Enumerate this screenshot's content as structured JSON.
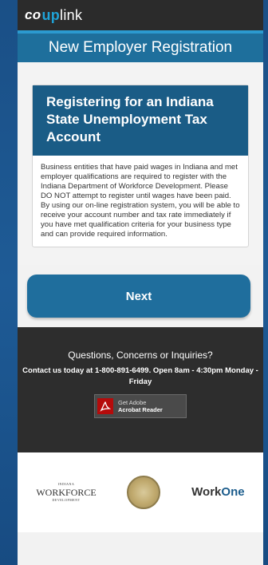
{
  "brand": {
    "co": "co",
    "up": "up",
    "link": "link"
  },
  "page_title": "New Employer Registration",
  "card": {
    "heading": "Registering for an Indiana State Unemployment Tax Account",
    "body": "Business entities that have paid wages in Indiana and met employer qualifications are required to register with the Indiana Department of Workforce Development. Please DO NOT attempt to register until wages have been paid. By using our on-line registration system, you will be able to receive your account number and tax rate immediately if you have met qualification criteria for your business type and can provide required information."
  },
  "next_label": "Next",
  "footer": {
    "question": "Questions, Concerns or Inquiries?",
    "contact": "Contact us today at 1-800-891-6499. Open 8am - 4:30pm Monday - Friday",
    "adobe_small": "Get Adobe",
    "adobe_bold": "Acrobat Reader"
  },
  "logos": {
    "workforce_top": "INDIANA",
    "workforce": "WORKFORCE",
    "workforce_bottom": "DEVELOPMENT",
    "workone_a": "Work",
    "workone_b": "One"
  },
  "colors": {
    "accent": "#1e6f9c",
    "brand_blue": "#1fa3d8",
    "dark": "#2d2d2d"
  },
  "icons": {
    "adobe": "pdf-icon",
    "seal": "state-seal-icon"
  }
}
